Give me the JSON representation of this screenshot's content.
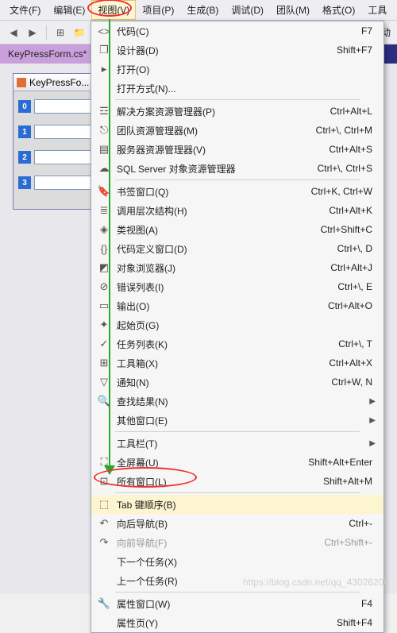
{
  "menubar": {
    "file": "文件(F)",
    "edit": "编辑(E)",
    "view": "视图(V)",
    "project": "项目(P)",
    "build": "生成(B)",
    "debug": "调试(D)",
    "team": "团队(M)",
    "format": "格式(O)",
    "tools": "工具"
  },
  "toolbar": {
    "run": "启动"
  },
  "tab": {
    "name": "KeyPressForm.cs*"
  },
  "form": {
    "title": "KeyPressFo...",
    "tags": [
      "0",
      "1",
      "2",
      "3"
    ]
  },
  "menu": [
    {
      "type": "item",
      "ico": "<>",
      "label": "代码(C)",
      "shortcut": "F7"
    },
    {
      "type": "item",
      "ico": "❐",
      "label": "设计器(D)",
      "shortcut": "Shift+F7"
    },
    {
      "type": "item",
      "ico": "▸",
      "label": "打开(O)",
      "shortcut": ""
    },
    {
      "type": "item",
      "ico": "",
      "label": "打开方式(N)...",
      "shortcut": ""
    },
    {
      "type": "sep"
    },
    {
      "type": "item",
      "ico": "☲",
      "label": "解决方案资源管理器(P)",
      "shortcut": "Ctrl+Alt+L"
    },
    {
      "type": "item",
      "ico": "⎋",
      "label": "团队资源管理器(M)",
      "shortcut": "Ctrl+\\, Ctrl+M"
    },
    {
      "type": "item",
      "ico": "▤",
      "label": "服务器资源管理器(V)",
      "shortcut": "Ctrl+Alt+S"
    },
    {
      "type": "item",
      "ico": "☁",
      "label": "SQL Server 对象资源管理器",
      "shortcut": "Ctrl+\\, Ctrl+S"
    },
    {
      "type": "sep"
    },
    {
      "type": "item",
      "ico": "🔖",
      "label": "书签窗口(Q)",
      "shortcut": "Ctrl+K, Ctrl+W"
    },
    {
      "type": "item",
      "ico": "≣",
      "label": "调用层次结构(H)",
      "shortcut": "Ctrl+Alt+K"
    },
    {
      "type": "item",
      "ico": "◈",
      "label": "类视图(A)",
      "shortcut": "Ctrl+Shift+C"
    },
    {
      "type": "item",
      "ico": "{}",
      "label": "代码定义窗口(D)",
      "shortcut": "Ctrl+\\, D"
    },
    {
      "type": "item",
      "ico": "◩",
      "label": "对象浏览器(J)",
      "shortcut": "Ctrl+Alt+J"
    },
    {
      "type": "item",
      "ico": "⊘",
      "label": "错误列表(I)",
      "shortcut": "Ctrl+\\, E"
    },
    {
      "type": "item",
      "ico": "▭",
      "label": "输出(O)",
      "shortcut": "Ctrl+Alt+O"
    },
    {
      "type": "item",
      "ico": "✦",
      "label": "起始页(G)",
      "shortcut": ""
    },
    {
      "type": "item",
      "ico": "✓",
      "label": "任务列表(K)",
      "shortcut": "Ctrl+\\, T"
    },
    {
      "type": "item",
      "ico": "⊞",
      "label": "工具箱(X)",
      "shortcut": "Ctrl+Alt+X"
    },
    {
      "type": "item",
      "ico": "▽",
      "label": "通知(N)",
      "shortcut": "Ctrl+W, N"
    },
    {
      "type": "sub",
      "ico": "🔍",
      "label": "查找结果(N)"
    },
    {
      "type": "sub",
      "ico": "",
      "label": "其他窗口(E)"
    },
    {
      "type": "sep"
    },
    {
      "type": "sub",
      "ico": "",
      "label": "工具栏(T)"
    },
    {
      "type": "item",
      "ico": "⛶",
      "label": "全屏幕(U)",
      "shortcut": "Shift+Alt+Enter"
    },
    {
      "type": "item",
      "ico": "⊡",
      "label": "所有窗口(L)",
      "shortcut": "Shift+Alt+M"
    },
    {
      "type": "sep"
    },
    {
      "type": "item",
      "ico": "⬚",
      "label": "Tab 键顺序(B)",
      "shortcut": "",
      "highlight": true
    },
    {
      "type": "item",
      "ico": "↶",
      "label": "向后导航(B)",
      "shortcut": "Ctrl+-"
    },
    {
      "type": "item",
      "ico": "↷",
      "label": "向前导航(F)",
      "shortcut": "Ctrl+Shift+-",
      "disabled": true
    },
    {
      "type": "item",
      "ico": "",
      "label": "下一个任务(X)",
      "shortcut": ""
    },
    {
      "type": "item",
      "ico": "",
      "label": "上一个任务(R)",
      "shortcut": ""
    },
    {
      "type": "sep"
    },
    {
      "type": "item",
      "ico": "🔧",
      "label": "属性窗口(W)",
      "shortcut": "F4"
    },
    {
      "type": "item",
      "ico": "",
      "label": "属性页(Y)",
      "shortcut": "Shift+F4"
    }
  ],
  "watermark": "https://blog.csdn.net/qq_43026206"
}
